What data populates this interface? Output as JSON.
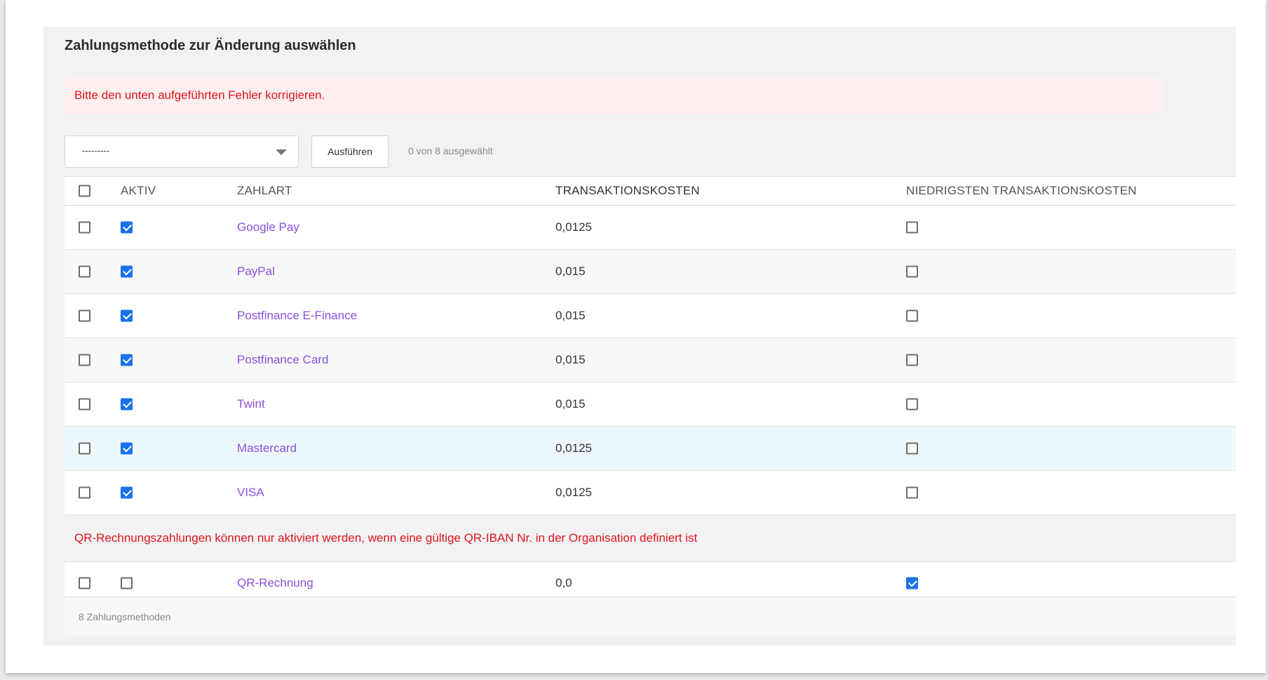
{
  "page": {
    "title": "Zahlungsmethode zur Änderung auswählen",
    "error_message": "Bitte den unten aufgeführten Fehler korrigieren."
  },
  "actions": {
    "select_value": "---------",
    "run_label": "Ausführen",
    "selection_counter": "0 von 8 ausgewählt"
  },
  "table": {
    "headers": {
      "active": "AKTIV",
      "name": "ZAHLART",
      "cost": "TRANSAKTIONSKOSTEN",
      "lowest": "NIEDRIGSTEN TRANSAKTIONSKOSTEN"
    },
    "rows": [
      {
        "name": "Google Pay",
        "cost": "0,0125",
        "active": true,
        "lowest": false,
        "selected": false
      },
      {
        "name": "PayPal",
        "cost": "0,015",
        "active": true,
        "lowest": false,
        "selected": false
      },
      {
        "name": "Postfinance E-Finance",
        "cost": "0,015",
        "active": true,
        "lowest": false,
        "selected": false
      },
      {
        "name": "Postfinance Card",
        "cost": "0,015",
        "active": true,
        "lowest": false,
        "selected": false
      },
      {
        "name": "Twint",
        "cost": "0,015",
        "active": true,
        "lowest": false,
        "selected": false
      },
      {
        "name": "Mastercard",
        "cost": "0,0125",
        "active": true,
        "lowest": false,
        "selected": false
      },
      {
        "name": "VISA",
        "cost": "0,0125",
        "active": true,
        "lowest": false,
        "selected": false
      }
    ],
    "notice": "QR-Rechnungszahlungen können nur aktiviert werden, wenn eine gültige QR-IBAN Nr. in der Organisation definiert ist",
    "qr_row": {
      "name": "QR-Rechnung",
      "cost": "0,0",
      "active": false,
      "lowest": true,
      "selected": false
    }
  },
  "footer": {
    "count_text": "8 Zahlungsmethoden"
  },
  "colors": {
    "link": "#8b4fe0",
    "error": "#e0141e",
    "checkbox_checked": "#1a73e8",
    "error_bg": "#ffefef"
  }
}
